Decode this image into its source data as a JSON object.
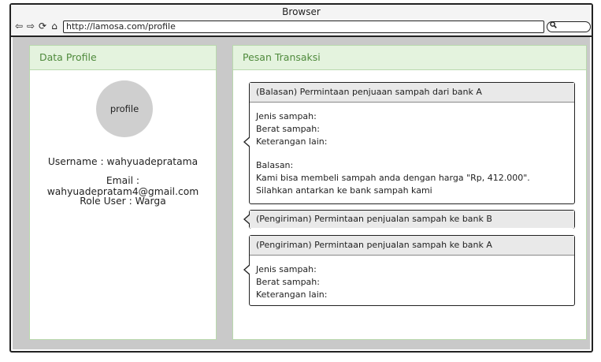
{
  "browser": {
    "title": "Browser",
    "back_icon": "⇦",
    "forward_icon": "⇨",
    "reload_icon": "⟳",
    "home_icon": "⌂",
    "url": "http://lamosa.com/profile",
    "search_icon": "🔍"
  },
  "profile": {
    "title": "Data Profile",
    "avatar_label": "profile",
    "username_line": "Username : wahyuadepratama",
    "email_line": "Email : wahyuadepratam4@gmail.com",
    "role_line": "Role User : Warga"
  },
  "transactions": {
    "title": "Pesan Transaksi",
    "items": [
      {
        "header": "(Balasan) Permintaan penjuaan sampah dari bank A",
        "lines": [
          "Jenis sampah:",
          "Berat sampah:",
          "Keterangan lain:"
        ],
        "reply_label": "Balasan:",
        "reply_text": "Kami bisa membeli sampah anda dengan harga \"Rp, 412.000\". Silahkan antarkan ke bank sampah kami"
      },
      {
        "header": "(Pengiriman) Permintaan penjualan sampah ke bank B"
      },
      {
        "header": "(Pengiriman) Permintaan penjualan sampah ke bank A",
        "lines": [
          "Jenis sampah:",
          "Berat sampah:",
          "Keterangan lain:"
        ]
      }
    ]
  },
  "colors": {
    "panel_header_bg": "#e4f3de",
    "panel_header_text": "#4f8a3c",
    "canvas_bg": "#c9c9c9"
  }
}
